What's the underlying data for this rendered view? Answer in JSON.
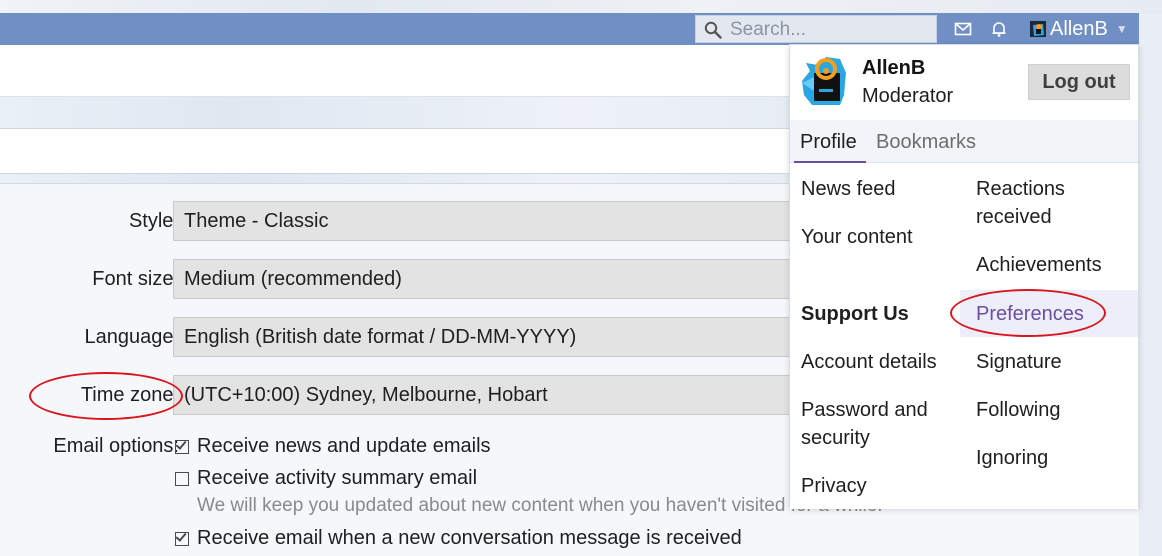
{
  "navbar": {
    "search_placeholder": "Search...",
    "user_name": "AllenB",
    "icons": [
      "search-icon",
      "envelope-icon",
      "bell-icon",
      "chevron-down-icon"
    ]
  },
  "form": {
    "style_label": "Style:",
    "style_value": "Theme - Classic",
    "font_size_label": "Font size:",
    "font_size_value": "Medium (recommended)",
    "language_label": "Language:",
    "language_value": "English (British date format / DD-MM-YYYY)",
    "timezone_label": "Time zone:",
    "timezone_value": "(UTC+10:00) Sydney, Melbourne, Hobart",
    "email_options_label": "Email options:",
    "email_options": [
      {
        "label": "Receive news and update emails",
        "checked": true
      },
      {
        "label": "Receive activity summary email",
        "checked": false
      },
      {
        "label": "Receive email when a new conversation message is received",
        "checked": true
      }
    ],
    "activity_hint": "We will keep you updated about new content when you haven't visited for a while."
  },
  "menu": {
    "user_name": "AllenB",
    "user_role": "Moderator",
    "logout_label": "Log out",
    "tabs": {
      "profile": "Profile",
      "bookmarks": "Bookmarks"
    },
    "left_links": {
      "news_feed": "News feed",
      "your_content": "Your content",
      "support_us": "Support Us",
      "account_details": "Account details",
      "password_security_1": "Password and",
      "password_security_2": "security",
      "privacy": "Privacy"
    },
    "right_links": {
      "reactions_1": "Reactions",
      "reactions_2": "received",
      "achievements": "Achievements",
      "preferences": "Preferences",
      "signature": "Signature",
      "following": "Following",
      "ignoring": "Ignoring"
    }
  },
  "colors": {
    "navbar": "#6f8fc5",
    "accent": "#6b4ea0",
    "annotation": "#d9161d",
    "avatar_blue": "#2aa6e0",
    "avatar_orange": "#f0a01e"
  }
}
